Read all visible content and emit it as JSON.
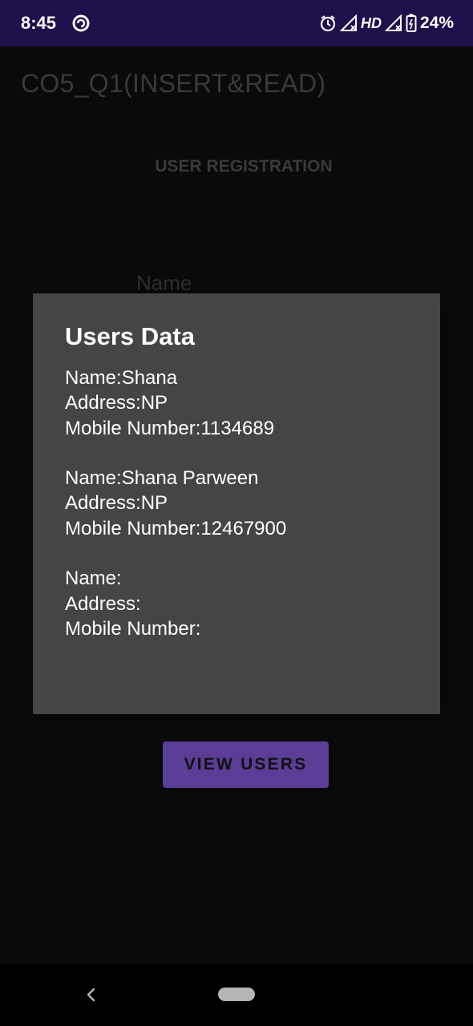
{
  "status_bar": {
    "time": "8:45",
    "network_label": "HD",
    "battery_percent": "24%",
    "icons": [
      "app-notification-icon",
      "alarm-icon",
      "signal-icon",
      "signal-icon",
      "battery-charging-icon"
    ]
  },
  "app": {
    "title": "CO5_Q1(INSERT&READ)",
    "section_title": "USER REGISTRATION",
    "name_field_hint": "Name",
    "view_users_label": "VIEW USERS"
  },
  "dialog": {
    "title": "Users Data",
    "records": [
      {
        "name": "Name:Shana",
        "address": "Address:NP",
        "mobile": "Mobile Number:1134689"
      },
      {
        "name": "Name:Shana Parween",
        "address": "Address:NP",
        "mobile": "Mobile Number:12467900"
      },
      {
        "name": "Name:",
        "address": "Address:",
        "mobile": "Mobile Number:"
      }
    ]
  },
  "colors": {
    "status_bar": "#1f0f4a",
    "background": "#0a0a0a",
    "dialog": "#454545",
    "button": "#5a3d96"
  }
}
